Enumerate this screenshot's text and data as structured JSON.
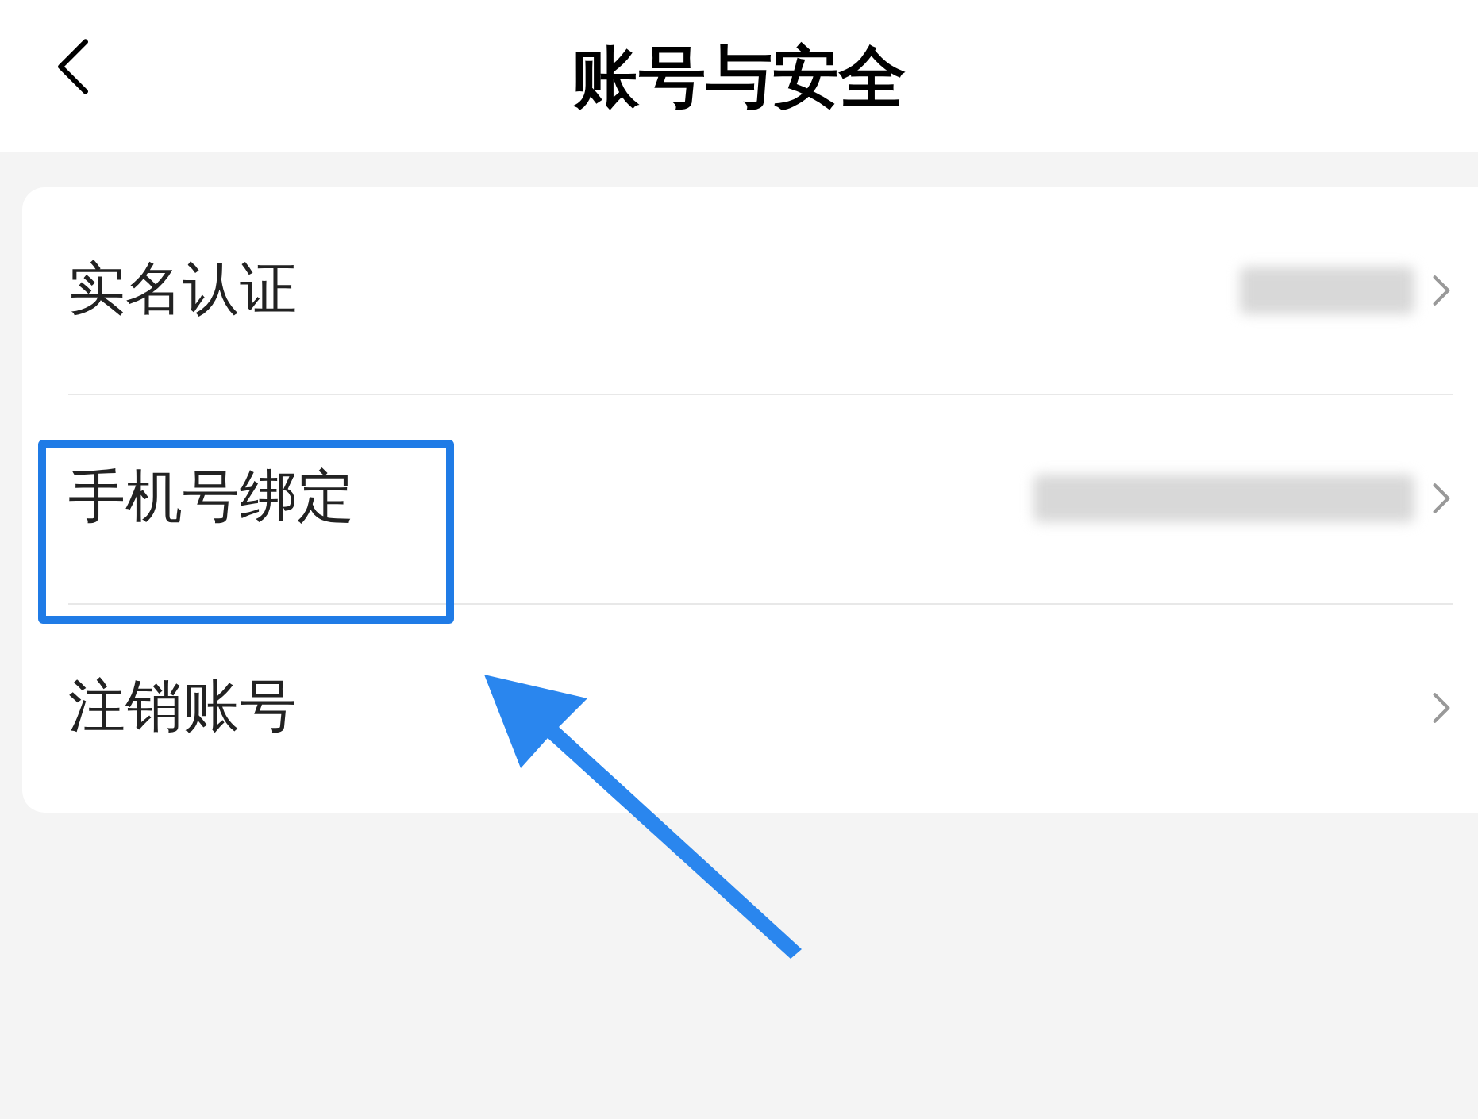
{
  "header": {
    "title": "账号与安全"
  },
  "items": [
    {
      "label": "实名认证",
      "masked": true,
      "highlighted": false
    },
    {
      "label": "手机号绑定",
      "masked": true,
      "highlighted": true
    },
    {
      "label": "注销账号",
      "masked": false,
      "highlighted": false
    }
  ]
}
